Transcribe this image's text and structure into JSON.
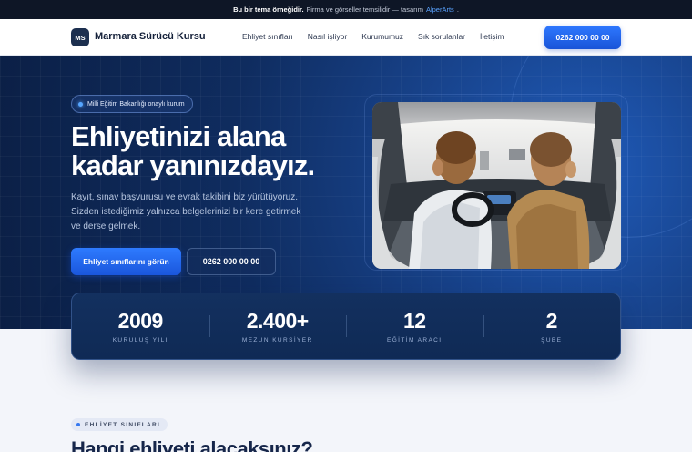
{
  "topbar": {
    "bold": "Bu bir tema örneğidir.",
    "text": "Firma ve görseller temsilidir — tasarım",
    "link": "AlperArts",
    "end": "."
  },
  "nav": {
    "logo_text": "MS",
    "brand": "Marmara Sürücü Kursu",
    "links": [
      "Ehliyet sınıfları",
      "Nasıl işliyor",
      "Kurumumuz",
      "Sık sorulanlar",
      "İletişim"
    ],
    "cta": "0262 000 00 00"
  },
  "hero": {
    "badge": "Milli Eğitim Bakanlığı onaylı kurum",
    "title_line1": "Ehliyetinizi alana",
    "title_line2": "kadar yanınızdayız.",
    "lead": "Kayıt, sınav başvurusu ve evrak takibini biz yürütüyoruz. Sizden istediğimiz yalnızca belgelerinizi bir kere getirmek ve derse gelmek.",
    "primary_button": "Ehliyet sınıflarını görün",
    "secondary_button": "0262 000 00 00"
  },
  "stats": [
    {
      "value": "2009",
      "label": "KURULUŞ YILI"
    },
    {
      "value": "2.400+",
      "label": "MEZUN KURSİYER"
    },
    {
      "value": "12",
      "label": "EĞİTİM ARACI"
    },
    {
      "value": "2",
      "label": "ŞUBE"
    }
  ],
  "section": {
    "eyebrow": "EHLİYET SINIFLARI",
    "title": "Hangi ehliyeti alacaksınız?"
  },
  "colors": {
    "accent": "#2563eb",
    "hero_dark": "#0b1f45",
    "text_dark": "#15213a"
  }
}
